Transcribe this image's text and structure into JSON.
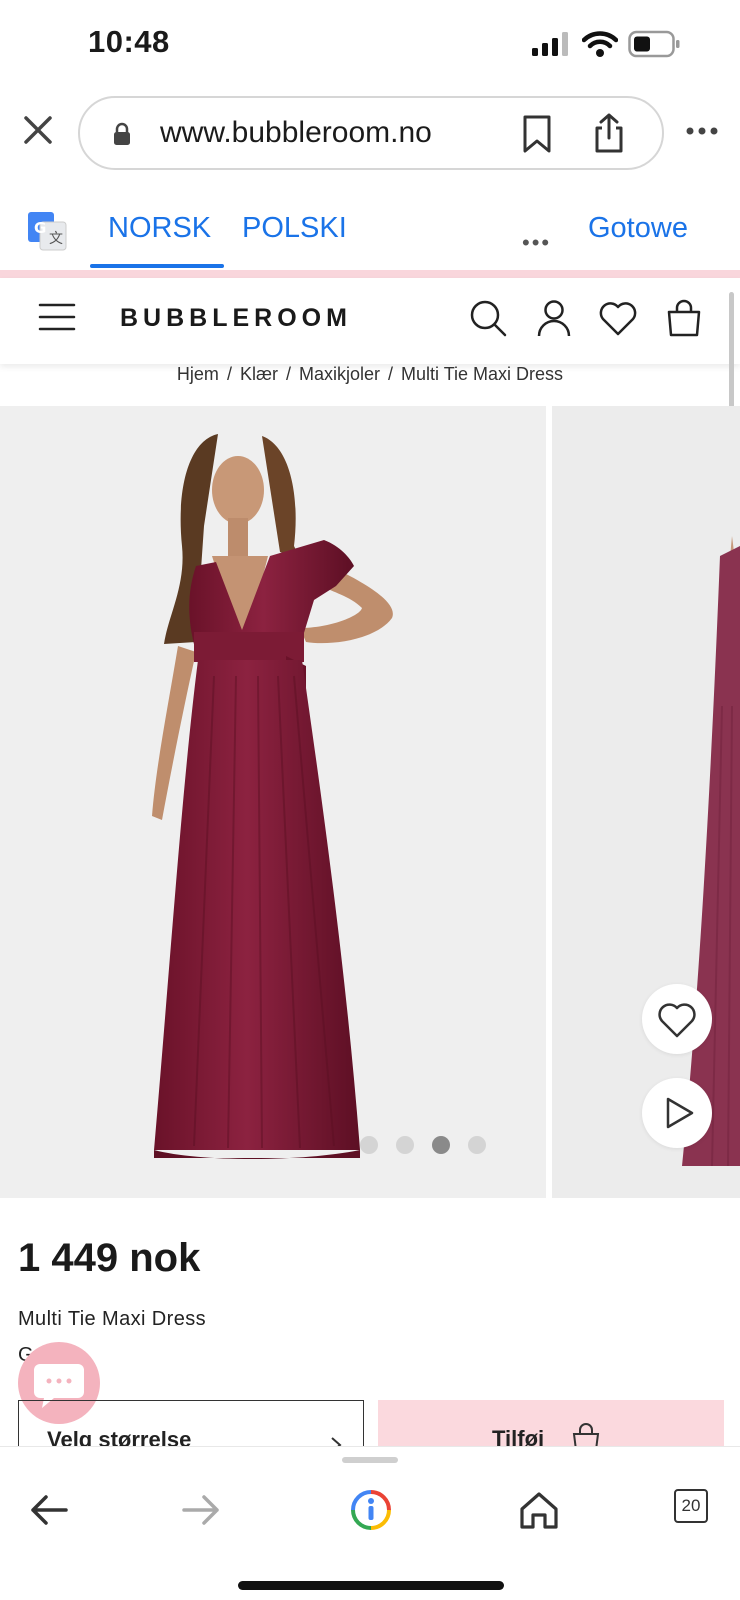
{
  "status_bar": {
    "time": "10:48"
  },
  "browser": {
    "url": "www.bubbleroom.no",
    "translate": {
      "languages": [
        "NORSK",
        "POLSKI"
      ],
      "active": "NORSK",
      "more": "•••",
      "done_label": "Gotowe"
    }
  },
  "site": {
    "logo": "BUBBLEROOM",
    "breadcrumb": [
      "Hjem",
      "/",
      "Klær",
      "/",
      "Maxikjoler",
      "/",
      "Multi Tie Maxi Dress"
    ]
  },
  "product": {
    "price": "1 449 nok",
    "name": "Multi Tie Maxi Dress",
    "brand": "G    VA",
    "size_select_label": "Velg størrelse",
    "add_to_cart_label": "Tilføj",
    "gallery": {
      "dots": 4,
      "active_dot": 3
    },
    "dress_color": "#7a1932"
  },
  "toolbar": {
    "tabs_count": "20"
  },
  "colors": {
    "accent_blue": "#1a73e8",
    "pink": "#fbd9de",
    "chat_pink": "#f4b3be"
  }
}
